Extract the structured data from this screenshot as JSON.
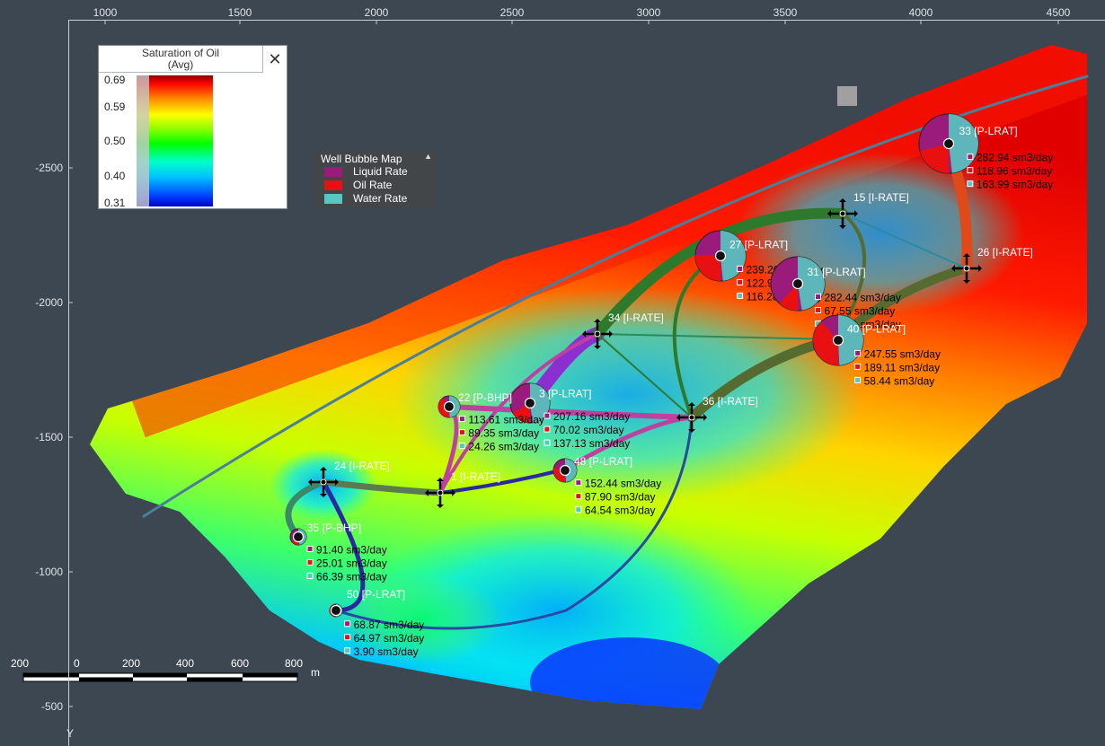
{
  "axes": {
    "x_ticks": [
      "1000",
      "1500",
      "2000",
      "2500",
      "3000",
      "3500",
      "4000",
      "4500"
    ],
    "y_ticks": [
      "-2500",
      "-2000",
      "-1500",
      "-1000",
      "-500"
    ],
    "y_label": "Y"
  },
  "saturation_legend": {
    "title_line1": "Saturation of Oil",
    "title_line2": "(Avg)",
    "ticks": [
      "0.69",
      "0.59",
      "0.50",
      "0.40",
      "0.31"
    ],
    "close_glyph": "✕"
  },
  "bubble_legend": {
    "title": "Well Bubble Map",
    "items": [
      {
        "label": "Liquid Rate",
        "color": "#9b1b7c"
      },
      {
        "label": "Oil Rate",
        "color": "#e81010"
      },
      {
        "label": "Water Rate",
        "color": "#56c8c0"
      }
    ]
  },
  "scale_bar": {
    "ticks": [
      "200",
      "0",
      "200",
      "400",
      "600",
      "800"
    ],
    "unit": "m"
  },
  "wells": [
    {
      "label": "33 [P-LRAT]",
      "type": "producer",
      "rates": [
        "282.94 sm3/day",
        "118.96 sm3/day",
        "163.99 sm3/day"
      ]
    },
    {
      "label": "27 [P-LRAT]",
      "type": "producer",
      "rates": [
        "239.26 sm3/day",
        "122.98 sm3/day",
        "116.28 sm3/day"
      ]
    },
    {
      "label": "31 [P-LRAT]",
      "type": "producer",
      "rates": [
        "282.44 sm3/day",
        "67.55 sm3/day",
        "214.89 sm3/day"
      ]
    },
    {
      "label": "40 [P-LRAT]",
      "type": "producer",
      "rates": [
        "247.55 sm3/day",
        "189.11 sm3/day",
        "58.44 sm3/day"
      ]
    },
    {
      "label": "3 [P-LRAT]",
      "type": "producer",
      "rates": [
        "207.16 sm3/day",
        "70.02 sm3/day",
        "137.13 sm3/day"
      ]
    },
    {
      "label": "22 [P-BHP]",
      "type": "producer",
      "rates": [
        "113.61 sm3/day",
        "89.35 sm3/day",
        "24.26 sm3/day"
      ]
    },
    {
      "label": "48 [P-LRAT]",
      "type": "producer",
      "rates": [
        "152.44 sm3/day",
        "87.90 sm3/day",
        "64.54 sm3/day"
      ]
    },
    {
      "label": "35 [P-BHP]",
      "type": "producer",
      "rates": [
        "91.40 sm3/day",
        "25.01 sm3/day",
        "66.39 sm3/day"
      ]
    },
    {
      "label": "50 [P-LRAT]",
      "type": "producer",
      "rates": [
        "68.87 sm3/day",
        "64.97 sm3/day",
        "3.90 sm3/day"
      ]
    },
    {
      "label": "15 [I-RATE]",
      "type": "injector"
    },
    {
      "label": "26 [I-RATE]",
      "type": "injector"
    },
    {
      "label": "34 [I-RATE]",
      "type": "injector"
    },
    {
      "label": "36 [I-RATE]",
      "type": "injector"
    },
    {
      "label": "24 [I-RATE]",
      "type": "injector"
    },
    {
      "label": "1 [I-RATE]",
      "type": "injector"
    }
  ]
}
